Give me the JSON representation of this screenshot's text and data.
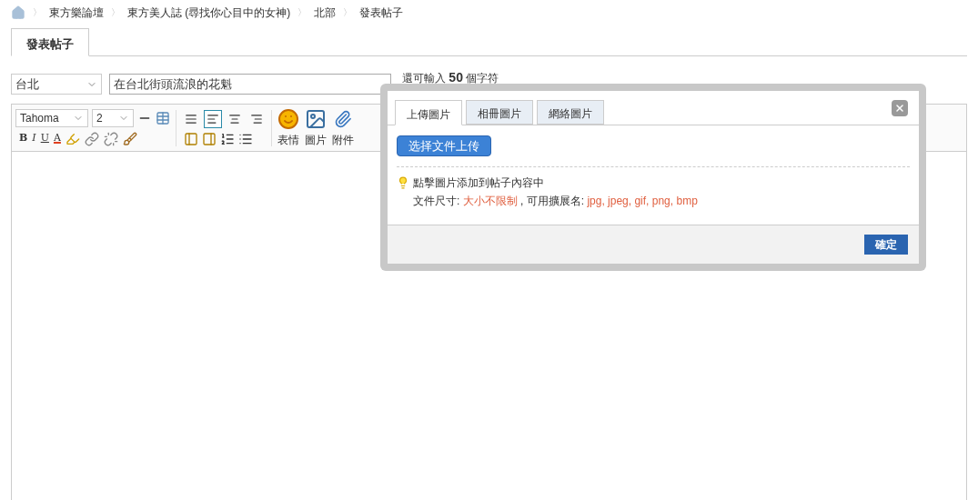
{
  "breadcrumb_separator": "〉",
  "breadcrumb": [
    "東方樂論壇",
    "東方美人誌 (尋找你心目中的女神)",
    "北部",
    "發表帖子"
  ],
  "tabs": [
    {
      "label": "發表帖子",
      "selected": true
    }
  ],
  "form": {
    "category": "台北",
    "title": "在台北街頭流浪的花魁",
    "counter": {
      "prefix": "還可輸入",
      "count": "50",
      "suffix": "個字符"
    }
  },
  "editor": {
    "font": "Tahoma",
    "size": "2",
    "format_buttons": [
      {
        "kind": "bold",
        "label": "B"
      },
      {
        "kind": "italic",
        "label": "I"
      },
      {
        "kind": "underline",
        "label": "U"
      },
      {
        "kind": "color",
        "label": "A"
      }
    ],
    "align_buttons": [
      {
        "kind": "justify",
        "selected": false
      },
      {
        "kind": "left",
        "selected": true
      },
      {
        "kind": "center",
        "selected": false
      },
      {
        "kind": "right",
        "selected": false
      }
    ],
    "big_buttons": [
      {
        "kind": "emoji",
        "label": "表情"
      },
      {
        "kind": "image",
        "label": "圖片"
      },
      {
        "kind": "attach",
        "label": "附件"
      }
    ]
  },
  "dialog": {
    "tabs": [
      {
        "label": "上傳圖片",
        "selected": true
      },
      {
        "label": "相冊圖片",
        "selected": false
      },
      {
        "label": "網絡圖片",
        "selected": false
      }
    ],
    "upload_button": "选择文件上传",
    "hint": "點擊圖片添加到帖子內容中",
    "info": {
      "size_label": "文件尺寸:",
      "size_value": "大小不限制",
      "ext_label": ", 可用擴展名:",
      "ext_value": "jpg, jpeg, gif, png, bmp"
    },
    "confirm": "確定"
  }
}
